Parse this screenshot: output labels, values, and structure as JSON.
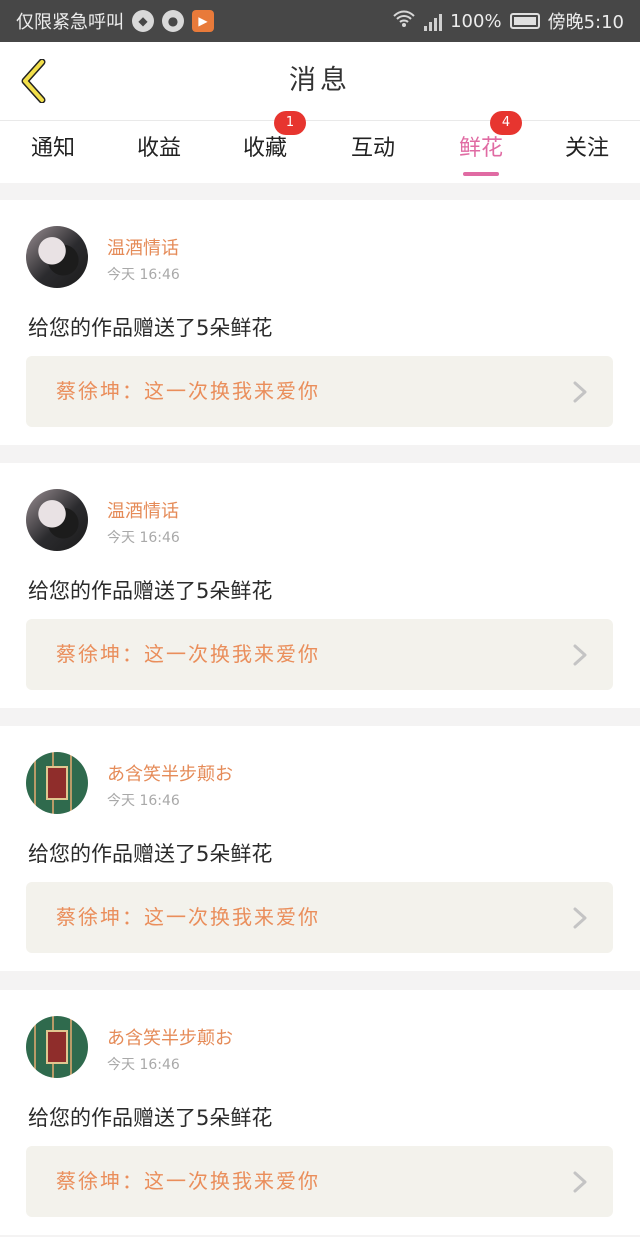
{
  "status_bar": {
    "carrier": "仅限紧急呼叫",
    "battery": "100%",
    "time": "傍晚5:10",
    "icons": [
      "notification-icon",
      "wechat-icon",
      "video-app-icon",
      "wifi-icon",
      "signal-icon",
      "battery-icon"
    ]
  },
  "header": {
    "title": "消息",
    "back_icon": "chevron-left-icon"
  },
  "tabs": [
    {
      "label": "通知",
      "badge": ""
    },
    {
      "label": "收益",
      "badge": ""
    },
    {
      "label": "收藏",
      "badge": "1"
    },
    {
      "label": "互动",
      "badge": ""
    },
    {
      "label": "鲜花",
      "badge": "4",
      "active": true
    },
    {
      "label": "关注",
      "badge": ""
    }
  ],
  "messages": [
    {
      "username": "温酒情话",
      "time": "今天 16:46",
      "text": "给您的作品赠送了5朵鲜花",
      "work": "蔡徐坤：这一次换我来爱你",
      "avatar": "avatar-girl"
    },
    {
      "username": "温酒情话",
      "time": "今天 16:46",
      "text": "给您的作品赠送了5朵鲜花",
      "work": "蔡徐坤：这一次换我来爱你",
      "avatar": "avatar-girl"
    },
    {
      "username": "あ含笑半步颠お",
      "time": "今天 16:46",
      "text": "给您的作品赠送了5朵鲜花",
      "work": "蔡徐坤：这一次换我来爱你",
      "avatar": "avatar-book"
    },
    {
      "username": "あ含笑半步颠お",
      "time": "今天 16:46",
      "text": "给您的作品赠送了5朵鲜花",
      "work": "蔡徐坤：这一次换我来爱你",
      "avatar": "avatar-book"
    }
  ],
  "colors": {
    "accent_pink": "#e06ba3",
    "username_orange": "#e58b58",
    "badge_red": "#e7352f",
    "back_icon_yellow": "#f2df4a"
  }
}
